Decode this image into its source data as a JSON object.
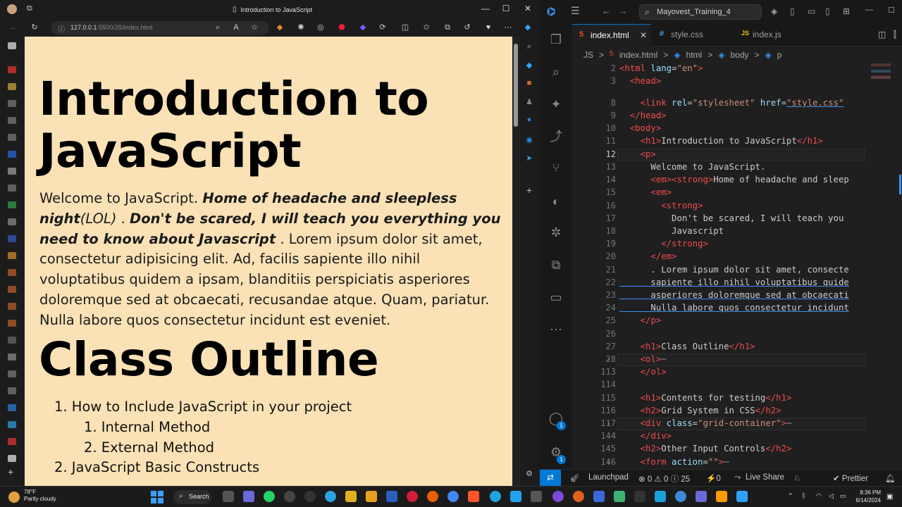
{
  "browser": {
    "tab_title": "Introduction to JavaScript",
    "url_host": "127.0.0.1",
    "url_rest": ":5500/JS/index.html",
    "window_controls": [
      "—",
      "☐",
      "✕"
    ]
  },
  "page": {
    "h1_intro_line1": "Introduction to",
    "h1_intro_line2": "JavaScript",
    "para_plain1": "Welcome to JavaScript. ",
    "para_bold_em1": "Home of headache and sleepless night",
    "para_em_lol": "(LOL)",
    "para_dot1": " . ",
    "para_bold_em2": "Don't be scared, I will teach you everything you need to know about Javascript",
    "para_plain2": " . Lorem ipsum dolor sit amet, consectetur adipisicing elit. Ad, facilis sapiente illo nihil voluptatibus quidem a ipsam, blanditiis perspiciatis asperiores doloremque sed at obcaecati, recusandae atque. Quam, pariatur. Nulla labore quos consectetur incidunt est eveniet.",
    "h1_outline": "Class Outline",
    "outline": [
      "1. How to Include JavaScript in your project",
      "1. Internal Method",
      "2. External Method",
      "2. JavaScript Basic Constructs"
    ]
  },
  "vscode": {
    "search": "Mayovest_Training_4",
    "tabs": [
      {
        "label": "index.html",
        "icon": "5",
        "close": "✕"
      },
      {
        "label": "style.css",
        "icon": "#"
      },
      {
        "label": "index.js",
        "icon": "JS"
      }
    ],
    "breadcrumb": [
      "JS",
      ">",
      "index.html",
      ">",
      "html",
      ">",
      "body",
      ">",
      "p"
    ],
    "line_numbers": [
      "2",
      "3",
      "8",
      "9",
      "10",
      "11",
      "12",
      "13",
      "14",
      "15",
      "16",
      "17",
      "18",
      "19",
      "20",
      "21",
      "22",
      "23",
      "24",
      "25",
      "26",
      "27",
      "28",
      "113",
      "114",
      "115",
      "116",
      "117",
      "144",
      "145",
      "146"
    ],
    "code": {
      "l2a": "<",
      "l2b": "html",
      "l2c": " lang",
      "l2d": "=",
      "l2e": "\"en\"",
      "l2f": ">",
      "l3": "head",
      "l8a": "link",
      "l8b": " rel",
      "l8c": "\"stylesheet\"",
      "l8d": " href",
      "l8e": "\"style.css\"",
      "l9": "head",
      "l10": "body",
      "l11_tag": "h1",
      "l11_text": "Introduction to JavaScript",
      "l12": "p",
      "l13": "Welcome to JavaScript.",
      "l14_em": "em",
      "l14_strong": "strong",
      "l14_text": "Home of headache and sleep",
      "l15": "em",
      "l16": "strong",
      "l17": "Don't be scared, I will teach you",
      "l18": "Javascript",
      "l19": "strong",
      "l20": "em",
      "l21": ". Lorem ipsum dolor sit amet, consecte",
      "l22": "sapiente illo nihil voluptatibus quide",
      "l23": "asperiores doloremque sed at obcaecati",
      "l24": "Nulla labore quos consectetur incidunt",
      "l25": "p",
      "l27_tag": "h1",
      "l27_text": "Class Outline",
      "l28": "ol",
      "l28_more": "⋯",
      "l113": "ol",
      "l115_tag": "h1",
      "l115_text": "Contents for testing",
      "l116_tag": "h2",
      "l116_text": "Grid System in CSS",
      "l117_tag": "div",
      "l117_attr": " class",
      "l117_val": "\"grid-container\"",
      "l117_more": "⋯",
      "l144": "div",
      "l145_tag": "h2",
      "l145_text": "Other Input Controls",
      "l146_tag": "form",
      "l146_attr": " action",
      "l146_val": "\"\"",
      "l146_more": "⋯"
    },
    "status": {
      "launchpad": "Launchpad",
      "problems": "⊗ 0 ⚠ 0 ⓘ 25",
      "ports": "⚡0",
      "liveshare": "Live Share",
      "prettier": "✔ Prettier"
    },
    "badge": "1"
  },
  "taskbar": {
    "temp": "78°F",
    "weather": "Partly cloudy",
    "search": "Search",
    "time": "8:36 PM",
    "date": "6/14/2024"
  }
}
